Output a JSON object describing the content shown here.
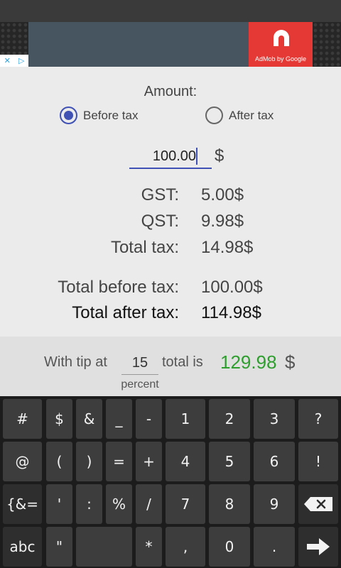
{
  "ad": {
    "caption": "AdMob by Google",
    "icons": [
      "✕",
      "▷"
    ],
    "brand_color": "#e53935"
  },
  "calculator": {
    "amount_label": "Amount:",
    "before_tax_label": "Before tax",
    "after_tax_label": "After tax",
    "selected": "Before tax",
    "amount_value": "100.00",
    "currency": "$",
    "gst_label": "GST:",
    "gst_value": "5.00$",
    "qst_label": "QST:",
    "qst_value": "9.98$",
    "total_tax_label": "Total tax:",
    "total_tax_value": "14.98$",
    "total_before_label": "Total before tax:",
    "total_before_value": "100.00$",
    "total_after_label": "Total after tax:",
    "total_after_value": "114.98$"
  },
  "tip": {
    "with_tip_label": "With tip at",
    "tip_value": "15",
    "total_is_label": "total is",
    "total_value": "129.98",
    "currency": "$",
    "percent_label": "percent",
    "total_color": "#2e9e2e"
  },
  "keyboard": {
    "rows": [
      [
        "#",
        "$",
        "&",
        "_",
        "-",
        "1",
        "2",
        "3",
        "?"
      ],
      [
        "@",
        "(",
        ")",
        "=",
        "+",
        "4",
        "5",
        "6",
        "!"
      ],
      [
        "{&=",
        "'",
        ":",
        "%",
        "/",
        "7",
        "8",
        "9",
        "backspace-icon"
      ],
      [
        "abc",
        "\"",
        "space",
        "*",
        ",",
        "0",
        ".",
        "enter-icon"
      ]
    ]
  }
}
